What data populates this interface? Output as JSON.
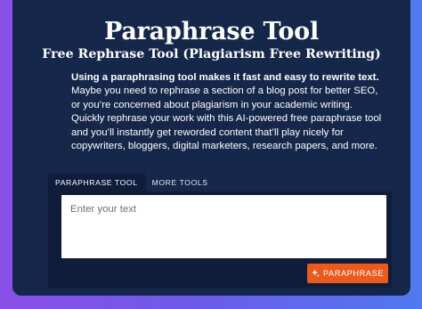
{
  "header": {
    "title": "Paraphrase Tool",
    "subtitle": "Free Rephrase Tool (Plagiarism Free Rewriting)"
  },
  "description": {
    "lead": "Using a paraphrasing tool makes it fast and easy to rewrite text.",
    "body": "Maybe you need to rephrase a section of a blog post for better SEO, or you’re concerned about plagiarism in your academic writing. Quickly rephrase your work with this AI-powered free paraphrase tool and you’ll instantly get reworded content that’ll play nicely for copywriters, bloggers, digital marketers, research papers, and more."
  },
  "tabs": [
    {
      "label": "PARAPHRASE TOOL",
      "active": true
    },
    {
      "label": "MORE TOOLS",
      "active": false
    }
  ],
  "editor": {
    "placeholder": "Enter your text",
    "value": ""
  },
  "actions": {
    "paraphrase_label": "PARAPHRASE",
    "paraphrase_icon": "sparkle-icon"
  },
  "colors": {
    "card_background": "#142649",
    "panel_background": "#0f1d3a",
    "button_accent": "#ea5a1c",
    "gradient_start": "#8a4fe6",
    "gradient_end": "#4f79ef"
  }
}
